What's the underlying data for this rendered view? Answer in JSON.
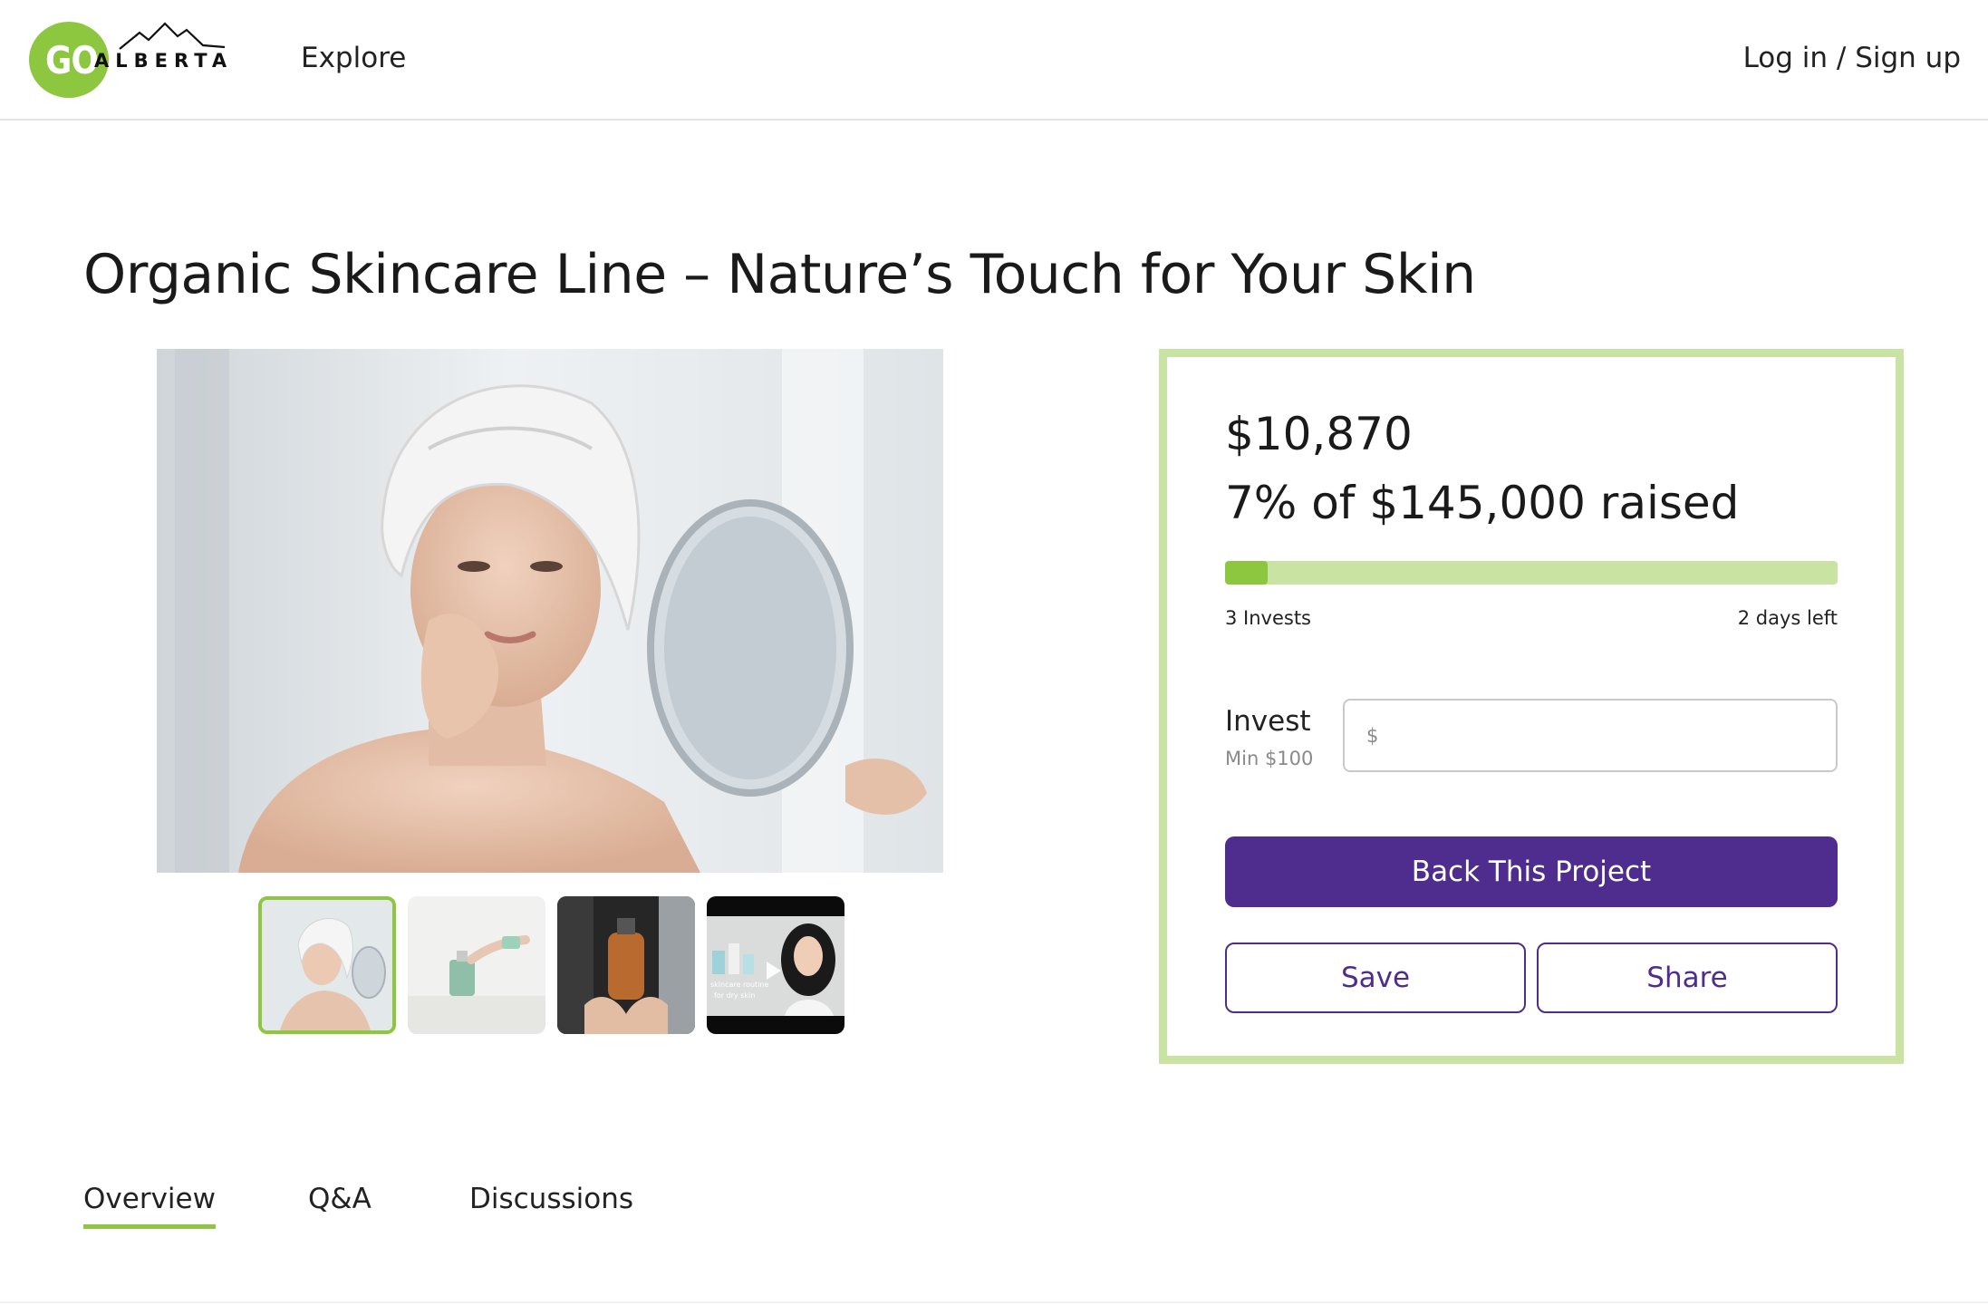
{
  "header": {
    "logo_go": "GO",
    "logo_word": "ALBERTA",
    "nav_explore": "Explore",
    "login_label": "Log in / Sign up"
  },
  "project": {
    "title": "Organic Skincare Line – Nature’s Touch for Your Skin"
  },
  "gallery": {
    "main_image": "woman-with-towel-and-mirror",
    "thumbnails": [
      {
        "subject": "woman-with-towel",
        "active": true
      },
      {
        "subject": "pouring-serum-bottle",
        "active": false
      },
      {
        "subject": "hands-holding-amber-bottle",
        "active": false
      },
      {
        "subject": "skincare-routine-video",
        "overlay_text": "skincare routine for dry skin",
        "active": false
      }
    ]
  },
  "funding": {
    "amount": "$10,870",
    "raised_text": "7% of $145,000 raised",
    "progress_percent": 7,
    "invests": "3 Invests",
    "days_left": "2 days left",
    "invest_label": "Invest",
    "invest_min": "Min $100",
    "invest_placeholder": "$",
    "back_button": "Back This Project",
    "save_button": "Save",
    "share_button": "Share"
  },
  "tabs": [
    {
      "label": "Overview",
      "active": true
    },
    {
      "label": "Q&A",
      "active": false
    },
    {
      "label": "Discussions",
      "active": false
    }
  ],
  "colors": {
    "brand_green": "#8dc63f",
    "light_green": "#c9e3a2",
    "accent_purple": "#4f2d8f"
  }
}
